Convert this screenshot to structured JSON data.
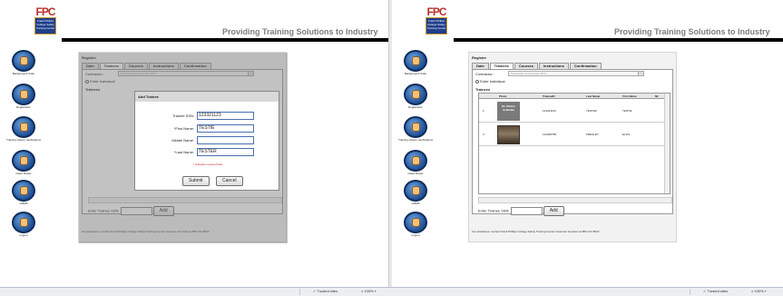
{
  "brand": {
    "logo_text": "FPC",
    "crest_text": "Frank Phillips College Safety Training Center",
    "tagline": "Providing Training Solutions to Industry"
  },
  "nav": [
    {
      "label": "Background Order",
      "icon": "background-order-icon"
    },
    {
      "label": "Registration",
      "icon": "registration-icon"
    },
    {
      "label": "Training History Verifications",
      "icon": "training-history-icon"
    },
    {
      "label": "Class Roster",
      "icon": "class-roster-icon"
    },
    {
      "label": "CMMS",
      "icon": "cmms-icon"
    },
    {
      "label": "Logout",
      "icon": "logout-icon"
    }
  ],
  "register": {
    "title": "Register",
    "tabs": [
      "Date",
      "Trainees",
      "Courses",
      "Instructions",
      "Confirmation"
    ],
    "active_tab": "Trainees",
    "contractor_label": "Contractor:",
    "contractor_value": "Panhandle Construction RTX",
    "enter_individual": "Enter individual",
    "trainees_label": "Trainees",
    "enter_ssn_label": "Enter Trainee SSN:",
    "add_label": "Add",
    "footer": "For assistance: contact Frank Phillips College Safety Training Center Customer Services at 806-274-5523"
  },
  "modal": {
    "title": "Add Trainee",
    "fields": [
      {
        "label": "Trainee SSN:",
        "value": "123321123"
      },
      {
        "label": "*First Name:",
        "value": "TESTIE"
      },
      {
        "label": "Middle Name:",
        "value": ""
      },
      {
        "label": "*Last Name:",
        "value": "TESTER"
      }
    ],
    "required_note": "* indicates required field",
    "submit": "Submit",
    "cancel": "Cancel"
  },
  "grid": {
    "columns": [
      "",
      "Photo",
      "TraineeID",
      "Last Name",
      "First Name",
      "MI"
    ],
    "rows": [
      {
        "num": "2",
        "photo": "No Picture Available",
        "trainee_id": "123321123",
        "last": "TESTER",
        "first": "TESTIE",
        "mi": ""
      },
      {
        "num": "3",
        "photo": "",
        "trainee_id": "123456789",
        "last": "PRESLEY",
        "first": "ELVIS",
        "mi": ""
      }
    ]
  },
  "status": {
    "zone": "Trusted sites",
    "zoom": "100%"
  }
}
